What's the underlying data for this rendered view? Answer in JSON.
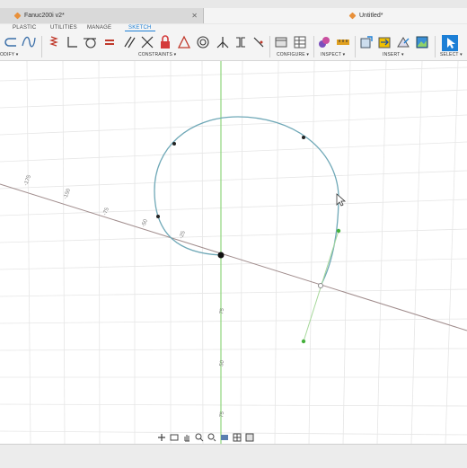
{
  "documents": {
    "left_tab_title": "Fanuc200i v2*",
    "right_tab_title": "Untitled*"
  },
  "ribbon_tabs": [
    "PLASTIC",
    "UTILITIES",
    "MANAGE",
    "SKETCH"
  ],
  "toolbar_groups": {
    "modify": "ODIFY ▾",
    "constraints": "CONSTRAINTS ▾",
    "configure": "CONFIGURE ▾",
    "inspect": "INSPECT ▾",
    "insert": "INSERT ▾",
    "select": "SELECT ▾"
  },
  "axis_labels": {
    "x_axis": [
      "-175",
      "-150",
      "-75",
      "-50",
      "-25"
    ],
    "y_axis": [
      "75",
      "50",
      "75"
    ]
  },
  "colors": {
    "sketch_curve": "#6fa8b7",
    "origin_axis_green": "#7ccf6a",
    "origin_axis_red": "#a08080",
    "accent": "#1c7fd6",
    "control_point": "#45b03c"
  }
}
